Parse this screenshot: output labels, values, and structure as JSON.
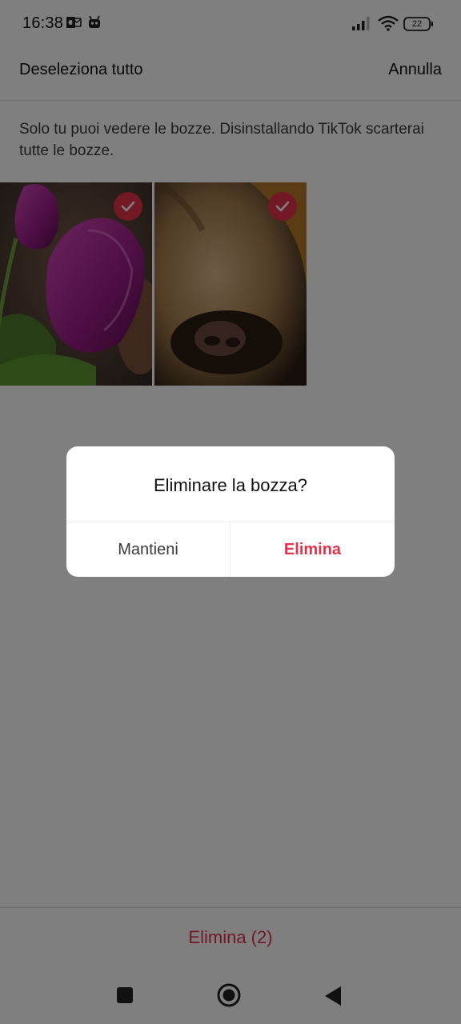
{
  "status_bar": {
    "time": "16:38",
    "battery": "22",
    "icons": [
      "outlook-icon",
      "bot-icon",
      "signal-icon",
      "wifi-icon",
      "battery-icon"
    ]
  },
  "header": {
    "deselect_label": "Deseleziona tutto",
    "cancel_label": "Annulla"
  },
  "info_text": "Solo tu puoi vedere le bozze. Disinstallando TikTok scarterai tutte le bozze.",
  "drafts": [
    {
      "name": "tulip-draft",
      "selected": true
    },
    {
      "name": "cat-draft",
      "selected": true
    }
  ],
  "bottom_bar": {
    "delete_label": "Elimina (2)"
  },
  "dialog": {
    "title": "Eliminare la bozza?",
    "keep_label": "Mantieni",
    "delete_label": "Elimina"
  },
  "nav": {
    "icons": [
      "recents-icon",
      "home-icon",
      "back-icon"
    ]
  },
  "colors": {
    "accent": "#e5324a",
    "scrim": "rgba(0,0,0,0.5)"
  }
}
